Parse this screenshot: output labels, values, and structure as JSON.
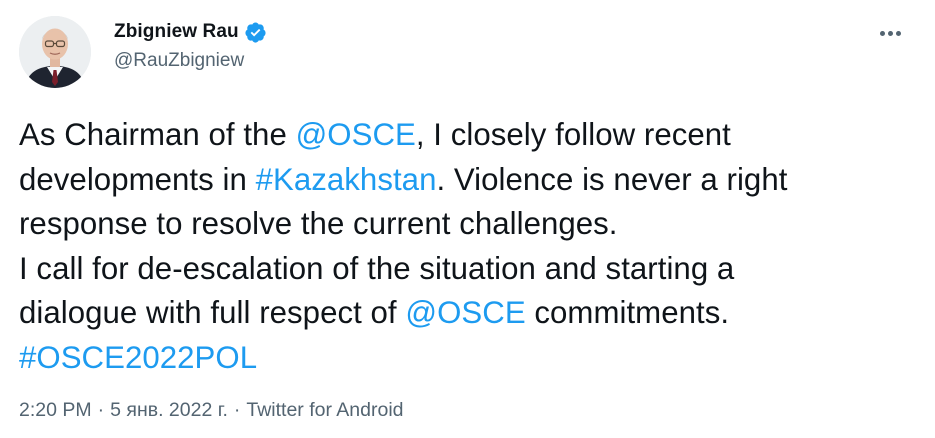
{
  "author": {
    "display_name": "Zbigniew Rau",
    "handle": "@RauZbigniew",
    "verified_icon": "verified-badge-icon"
  },
  "menu": {
    "more_icon": "more-horizontal-icon"
  },
  "tweet": {
    "line1": {
      "t1": "As Chairman of the ",
      "mention1": "@OSCE",
      "t2": ", I closely follow recent"
    },
    "line2": {
      "t1": "developments in ",
      "hashtag1": "#Kazakhstan",
      "t2": ". Violence is never a right"
    },
    "line3": "response to resolve the current challenges.",
    "line4": "I call for de-escalation of the situation and starting a",
    "line5": {
      "t1": "dialogue with full respect of ",
      "mention2": "@OSCE",
      "t2": " commitments."
    },
    "line6": {
      "hashtag2": "#OSCE2022POL"
    }
  },
  "meta": {
    "time": "2:20 PM",
    "separator": "·",
    "date": "5 янв. 2022 г.",
    "source": "Twitter for Android"
  },
  "colors": {
    "text": "#0f1419",
    "secondary": "#536471",
    "link": "#1d9bf0",
    "verified": "#1d9bf0"
  }
}
